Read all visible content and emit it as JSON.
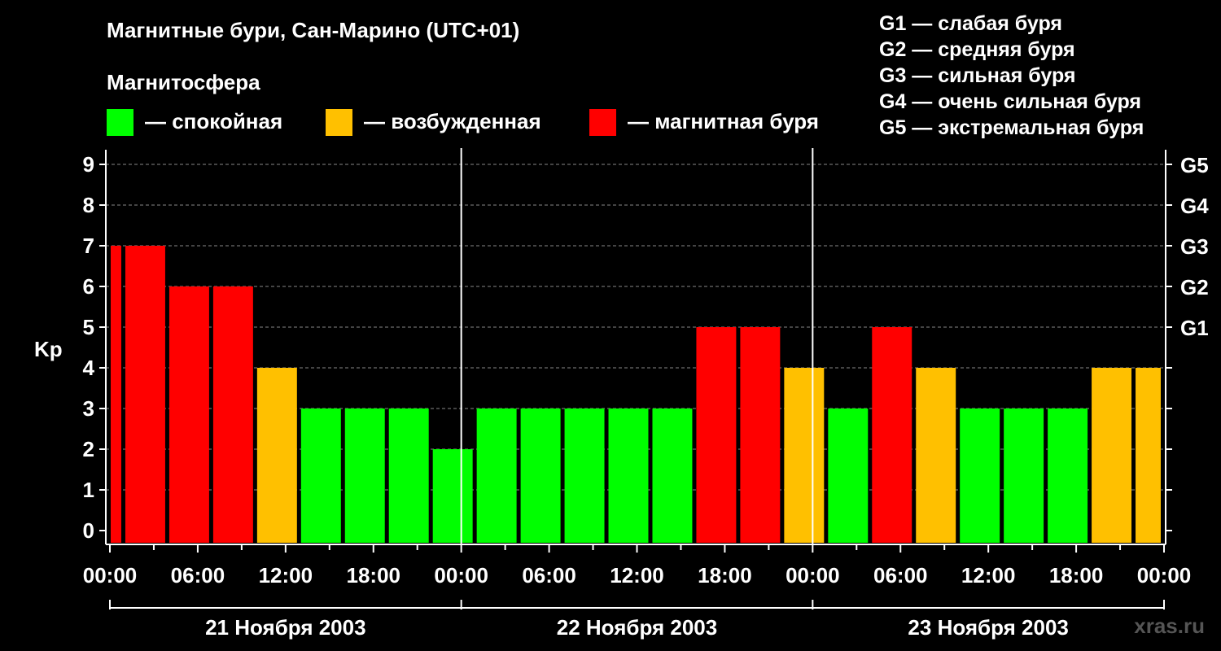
{
  "title": "Магнитные бури, Сан-Марино (UTC+01)",
  "legend": {
    "title": "Магнитосфера",
    "items": [
      {
        "label": "— спокойная",
        "color": "#00ff00"
      },
      {
        "label": "— возбужденная",
        "color": "#ffc000"
      },
      {
        "label": "— магнитная буря",
        "color": "#ff0000"
      }
    ]
  },
  "g_scale": [
    "G1 — слабая буря",
    "G2 — средняя буря",
    "G3 — сильная буря",
    "G4 — очень сильная буря",
    "G5 — экстремальная буря"
  ],
  "watermark": "xras.ru",
  "chart_data": {
    "type": "bar",
    "ylabel": "Kp",
    "ylim": [
      0,
      9
    ],
    "yticks": [
      "0",
      "1",
      "2",
      "3",
      "4",
      "5",
      "6",
      "7",
      "8",
      "9"
    ],
    "right_axis_labels": [
      {
        "kp": 5,
        "label": "G1"
      },
      {
        "kp": 6,
        "label": "G2"
      },
      {
        "kp": 7,
        "label": "G3"
      },
      {
        "kp": 8,
        "label": "G4"
      },
      {
        "kp": 9,
        "label": "G5"
      }
    ],
    "grid": "dashed horizontal",
    "xticks": [
      "00:00",
      "06:00",
      "12:00",
      "18:00",
      "00:00",
      "06:00",
      "12:00",
      "18:00",
      "00:00",
      "06:00",
      "12:00",
      "18:00",
      "00:00"
    ],
    "days": [
      "21 Ноября 2003",
      "22 Ноября 2003",
      "23 Ноября 2003"
    ],
    "color_key": {
      "quiet": "#00ff00",
      "active": "#ffc000",
      "storm": "#ff0000"
    },
    "bars": [
      {
        "start_hour": 0,
        "end_hour": 1,
        "kp": 7,
        "level": "storm"
      },
      {
        "start_hour": 1,
        "end_hour": 4,
        "kp": 7,
        "level": "storm"
      },
      {
        "start_hour": 4,
        "end_hour": 7,
        "kp": 6,
        "level": "storm"
      },
      {
        "start_hour": 7,
        "end_hour": 10,
        "kp": 6,
        "level": "storm"
      },
      {
        "start_hour": 10,
        "end_hour": 13,
        "kp": 4,
        "level": "active"
      },
      {
        "start_hour": 13,
        "end_hour": 16,
        "kp": 3,
        "level": "quiet"
      },
      {
        "start_hour": 16,
        "end_hour": 19,
        "kp": 3,
        "level": "quiet"
      },
      {
        "start_hour": 19,
        "end_hour": 22,
        "kp": 3,
        "level": "quiet"
      },
      {
        "start_hour": 22,
        "end_hour": 25,
        "kp": 2,
        "level": "quiet"
      },
      {
        "start_hour": 25,
        "end_hour": 28,
        "kp": 3,
        "level": "quiet"
      },
      {
        "start_hour": 28,
        "end_hour": 31,
        "kp": 3,
        "level": "quiet"
      },
      {
        "start_hour": 31,
        "end_hour": 34,
        "kp": 3,
        "level": "quiet"
      },
      {
        "start_hour": 34,
        "end_hour": 37,
        "kp": 3,
        "level": "quiet"
      },
      {
        "start_hour": 37,
        "end_hour": 40,
        "kp": 3,
        "level": "quiet"
      },
      {
        "start_hour": 40,
        "end_hour": 43,
        "kp": 5,
        "level": "storm"
      },
      {
        "start_hour": 43,
        "end_hour": 46,
        "kp": 5,
        "level": "storm"
      },
      {
        "start_hour": 46,
        "end_hour": 49,
        "kp": 4,
        "level": "active"
      },
      {
        "start_hour": 49,
        "end_hour": 52,
        "kp": 3,
        "level": "quiet"
      },
      {
        "start_hour": 52,
        "end_hour": 55,
        "kp": 5,
        "level": "storm"
      },
      {
        "start_hour": 55,
        "end_hour": 58,
        "kp": 4,
        "level": "active"
      },
      {
        "start_hour": 58,
        "end_hour": 61,
        "kp": 3,
        "level": "quiet"
      },
      {
        "start_hour": 61,
        "end_hour": 64,
        "kp": 3,
        "level": "quiet"
      },
      {
        "start_hour": 64,
        "end_hour": 67,
        "kp": 3,
        "level": "quiet"
      },
      {
        "start_hour": 67,
        "end_hour": 70,
        "kp": 4,
        "level": "active"
      },
      {
        "start_hour": 70,
        "end_hour": 72,
        "kp": 4,
        "level": "active"
      }
    ]
  }
}
